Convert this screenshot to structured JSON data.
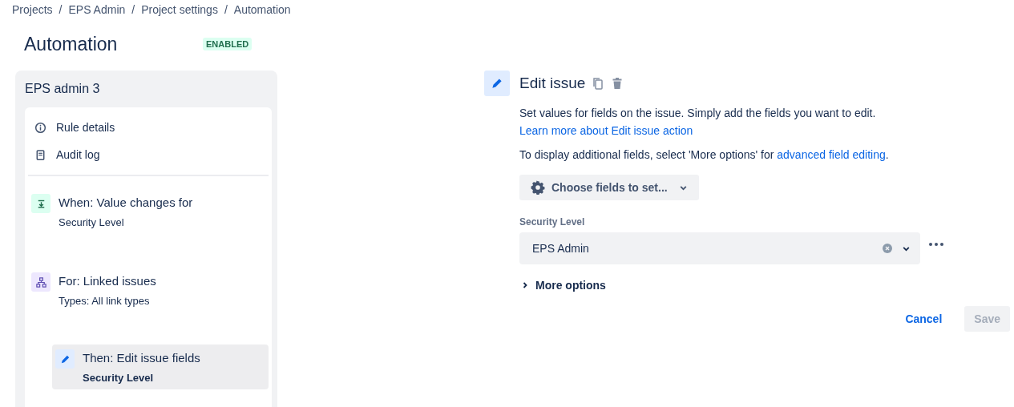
{
  "breadcrumbs": [
    {
      "label": "Projects"
    },
    {
      "separator": "/",
      "label": "EPS Admin"
    },
    {
      "separator": "/",
      "label": "Project settings"
    },
    {
      "separator": "/",
      "label": "Automation"
    }
  ],
  "page": {
    "title": "Automation",
    "status": "ENABLED"
  },
  "rule": {
    "name": "EPS admin 3",
    "menu": [
      {
        "kind": "info",
        "label": "Rule details"
      },
      {
        "kind": "log",
        "label": "Audit log"
      }
    ],
    "components": [
      {
        "kind": "trigger",
        "title": "When: Value changes for",
        "detail": "Security Level",
        "selected": false
      },
      {
        "kind": "branch",
        "title": "For: Linked issues",
        "detail": "Types: All link types",
        "selected": false,
        "children": [
          {
            "kind": "action",
            "title": "Then: Edit issue fields",
            "detail": "Security Level",
            "selected": true
          }
        ]
      }
    ]
  },
  "editor": {
    "title": "Edit issue",
    "description": [
      {
        "kind": "text",
        "text": "Set values for fields on the issue. Simply add the fields you want to edit. "
      },
      {
        "kind": "link",
        "text": "Learn more about Edit issue action"
      }
    ],
    "hint": [
      {
        "kind": "text",
        "text": "To display additional fields, select 'More options' for "
      },
      {
        "kind": "link",
        "text": "advanced field editing"
      },
      {
        "kind": "text",
        "text": "."
      }
    ],
    "choose_button": "Choose fields to set...",
    "field": {
      "label": "Security Level",
      "value": "EPS Admin"
    },
    "more_options": {
      "label": "More options",
      "expanded": false
    },
    "buttons": [
      {
        "kind": "link",
        "label": "Cancel",
        "disabled": false
      },
      {
        "kind": "primary",
        "label": "Save",
        "disabled": true
      }
    ]
  }
}
